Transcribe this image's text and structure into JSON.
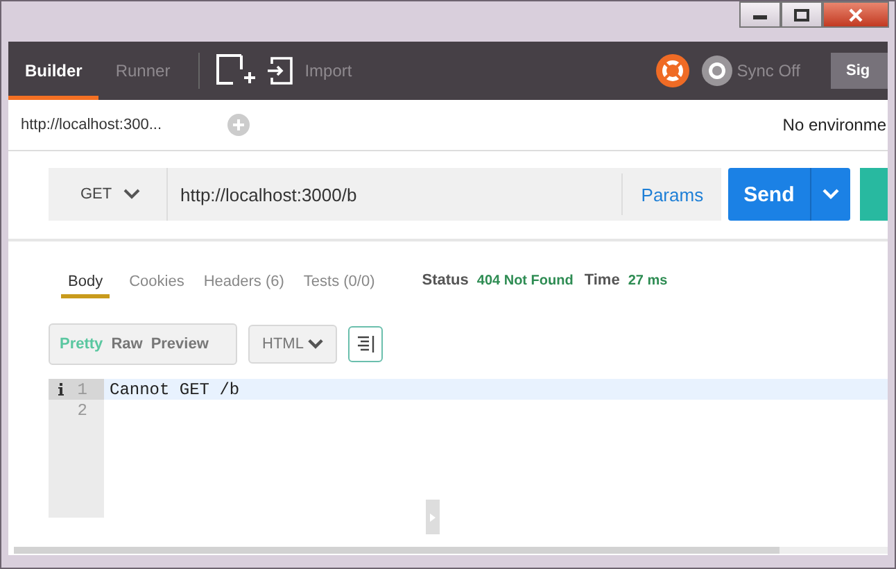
{
  "nav_tabs": [
    {
      "label": "Builder",
      "selected": true
    },
    {
      "label": "Runner",
      "selected": false
    }
  ],
  "import": {
    "label": "Import"
  },
  "sync": {
    "label": "Sync Off"
  },
  "sign_in": {
    "label": "Sig"
  },
  "request_tabs": [
    {
      "label": "http://localhost:300...",
      "selected": true
    }
  ],
  "environment": "No environme",
  "request": {
    "method": "GET",
    "url": "http://localhost:3000/b",
    "params": "Params",
    "send": "Send"
  },
  "response_tabs": [
    {
      "label": "Body",
      "selected": true
    },
    {
      "label": "Cookies",
      "selected": false
    },
    {
      "label": "Headers (6)",
      "selected": false
    },
    {
      "label": "Tests (0/0)",
      "selected": false
    }
  ],
  "status": {
    "label": "Status",
    "value": "404 Not Found",
    "time_label": "Time",
    "time": "27 ms"
  },
  "view_modes": [
    {
      "label": "Pretty",
      "selected": true
    },
    {
      "label": "Raw",
      "selected": false
    },
    {
      "label": "Preview",
      "selected": false
    }
  ],
  "format": "HTML",
  "lines": [
    {
      "number": "1",
      "text": "Cannot GET /b",
      "highlighted": true
    },
    {
      "number": "2",
      "highlighted": false
    }
  ]
}
